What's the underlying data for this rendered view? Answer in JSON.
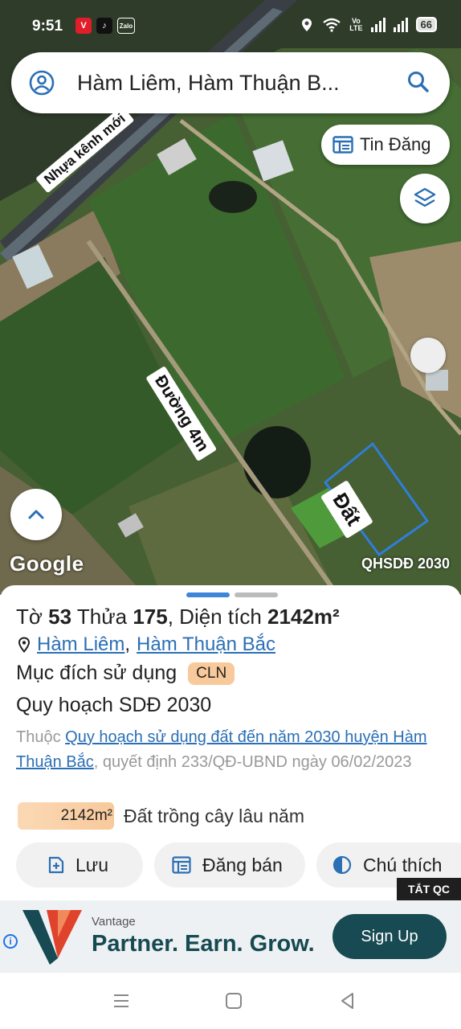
{
  "status_bar": {
    "time": "9:51",
    "app_icons": [
      "V",
      "♪",
      "Zalo"
    ],
    "network_label_1": "Vo",
    "network_label_2": "LTE",
    "battery": "66"
  },
  "search": {
    "value": "Hàm Liêm, Hàm Thuận B..."
  },
  "map": {
    "tin_dang_label": "Tin Đăng",
    "labels": {
      "road_new_canal": "Nhựa kênh mới",
      "road_4m": "Đường 4m",
      "land": "Đất"
    },
    "google_logo": "Google",
    "layer_name": "QHSDĐ 2030",
    "parcel_outline_color": "#2f7ed8"
  },
  "parcel": {
    "sheet_label": "Tờ",
    "sheet_no": "53",
    "plot_label": "Thửa",
    "plot_no": "175",
    "area_label": "Diện tích",
    "area": "2142m²",
    "location_commune": "Hàm Liêm",
    "location_district": "Hàm Thuận Bắc",
    "purpose_label": "Mục đích sử dụng",
    "purpose_code": "CLN",
    "plan_title": "Quy hoạch SDĐ 2030",
    "plan_prefix": "Thuộc",
    "plan_link": "Quy hoạch sử dụng đất đến năm 2030 huyện Hàm Thuận Bắc",
    "plan_suffix": ", quyết định 233/QĐ-UBND ngày 06/02/2023",
    "area_badge": "2142m²",
    "land_type": "Đất trồng cây lâu năm"
  },
  "actions": {
    "save": "Lưu",
    "sell": "Đăng bán",
    "legend": "Chú thích"
  },
  "ad": {
    "close_label": "TẮT QC",
    "brand": "Vantage",
    "slogan": "Partner. Earn. Grow.",
    "cta": "Sign Up",
    "info": "i"
  },
  "colors": {
    "accent_blue": "#2b6fb5",
    "badge_orange": "#f8c99b",
    "ad_teal": "#174a52",
    "ad_red": "#e0432c"
  }
}
